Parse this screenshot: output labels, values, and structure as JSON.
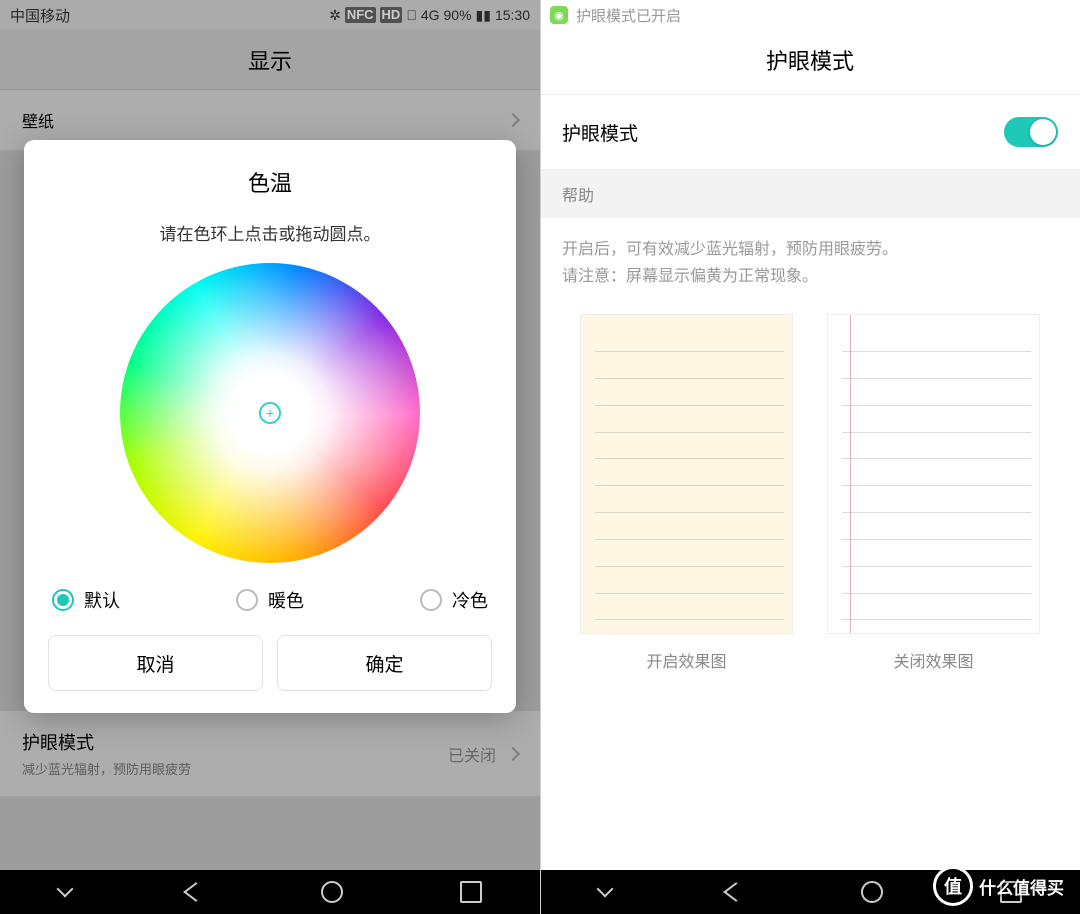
{
  "left": {
    "status": {
      "carrier": "中国移动",
      "nfc": "NFC",
      "hd": "HD",
      "signal": "4G",
      "battery_pct": "90%",
      "time": "15:30"
    },
    "header_title": "显示",
    "bg_rows": {
      "wallpaper": "壁纸",
      "eye_title": "护眼模式",
      "eye_sub": "减少蓝光辐射，预防用眼疲劳",
      "eye_status": "已关闭"
    },
    "modal": {
      "title": "色温",
      "instruction": "请在色环上点击或拖动圆点。",
      "options": {
        "default": "默认",
        "warm": "暖色",
        "cool": "冷色"
      },
      "btn_cancel": "取消",
      "btn_ok": "确定"
    }
  },
  "right": {
    "notif": "护眼模式已开启",
    "header_title": "护眼模式",
    "toggle_label": "护眼模式",
    "section_help": "帮助",
    "help_line1": "开启后，可有效减少蓝光辐射，预防用眼疲劳。",
    "help_line2": "请注意：屏幕显示偏黄为正常现象。",
    "preview_on": "开启效果图",
    "preview_off": "关闭效果图"
  },
  "watermark": {
    "badge": "值",
    "text": "什么值得买"
  }
}
